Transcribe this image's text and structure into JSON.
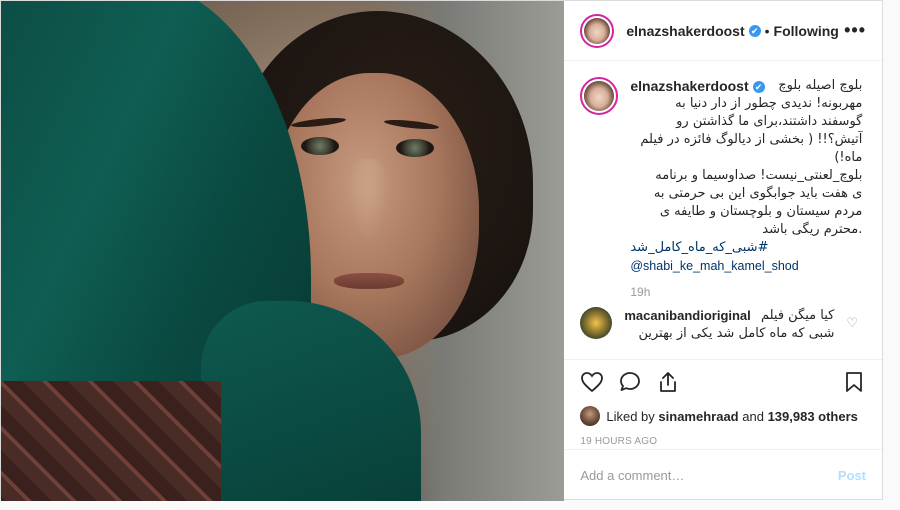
{
  "post": {
    "username": "elnazshakerdoost",
    "follow_label": "Following",
    "caption_lines": [
      "بلوچ اصیله بلوچ",
      "مهربونه! ندیدی چطور از دار دنیا به",
      "گوسفند داشتند،برای ما گذاشتن رو",
      "آتیش؟!! ( بخشی از دیالوگ فائزه در فیلم",
      "ماه!)",
      "بلوچ_لعنتی_نیست! صداوسیما و برنامه",
      "ی هفت باید جوابگوی این بی حرمتی به",
      "مردم سیستان و بلوچستان و طایفه ی",
      ".محترم ریگی باشد"
    ],
    "hashtag": "#شبی_که_ماه_کامل_شد",
    "mention": "@shabi_ke_mah_kamel_shod",
    "caption_time": "19h",
    "comment": {
      "username": "macanibandioriginal",
      "text_line1": "کیا میگن فیلم",
      "text_line2": "شبی که ماه کامل شد یکی از بهترین"
    },
    "liked_by_prefix": "Liked by",
    "liked_by_user": "sinamehraad",
    "liked_by_and": "and",
    "liked_by_count": "139,983 others",
    "timestamp": "19 HOURS AGO",
    "add_comment_placeholder": "Add a comment…",
    "post_label": "Post"
  },
  "icons": {
    "verified": "✔",
    "more": "•••",
    "dot": "•",
    "small_heart": "♡"
  }
}
